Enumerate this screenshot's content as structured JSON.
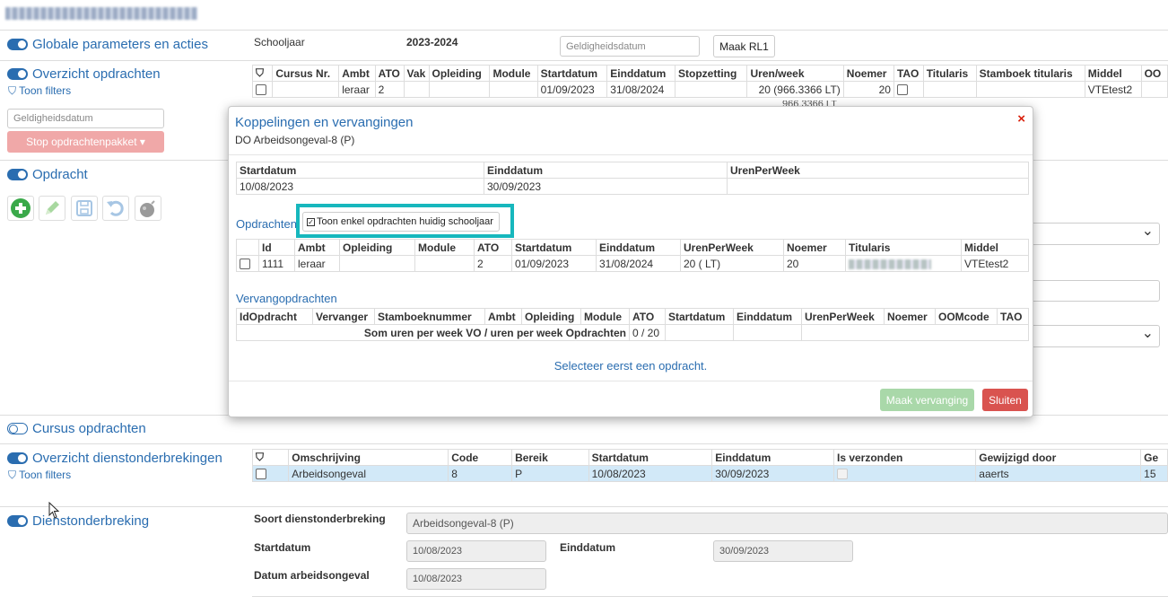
{
  "sections": {
    "globale": {
      "title": "Globale parameters en acties"
    },
    "overzicht_opdrachten": {
      "title": "Overzicht opdrachten",
      "filter_link": "Toon filters"
    },
    "opdracht": {
      "title": "Opdracht"
    },
    "cursus": {
      "title": "Cursus opdrachten"
    },
    "overzicht_dienst": {
      "title": "Overzicht dienstonderbrekingen",
      "filter_link": "Toon filters"
    },
    "dienstonderbreking": {
      "title": "Dienstonderbreking"
    }
  },
  "globale_params": {
    "schooljaar_label": "Schooljaar",
    "schooljaar_value": "2023-2024",
    "datum_placeholder": "Geldigheidsdatum",
    "maak_rl1": "Maak RL1"
  },
  "left_panel": {
    "datum_placeholder": "Geldigheidsdatum",
    "stop_button": "Stop opdrachtenpakket ▾"
  },
  "opdrachten_table": {
    "headers": [
      "Cursus Nr.",
      "Ambt",
      "ATO",
      "Vak",
      "Opleiding",
      "Module",
      "Startdatum",
      "Einddatum",
      "Stopzetting",
      "Uren/week",
      "Noemer",
      "TAO",
      "Titularis",
      "Stamboek titularis",
      "Middel",
      "OO"
    ],
    "row": [
      "",
      "leraar",
      "2",
      "",
      "",
      "",
      "01/09/2023",
      "31/08/2024",
      "",
      "20 (966.3366 LT)",
      "20",
      "",
      "",
      "",
      "VTEtest2",
      ""
    ],
    "partial": "966.3366 LT"
  },
  "dienst_table": {
    "headers": [
      "Omschrijving",
      "Code",
      "Bereik",
      "Startdatum",
      "Einddatum",
      "Is verzonden",
      "Gewijzigd door",
      "Ge"
    ],
    "row": [
      "Arbeidsongeval",
      "8",
      "P",
      "10/08/2023",
      "30/09/2023",
      "",
      "aaerts",
      "15"
    ]
  },
  "dienstonderbreking_form": {
    "soort_label": "Soort dienstonderbreking",
    "soort_value": "Arbeidsongeval-8 (P)",
    "start_label": "Startdatum",
    "start_value": "10/08/2023",
    "eind_label": "Einddatum",
    "eind_value": "30/09/2023",
    "datum_label": "Datum arbeidsongeval",
    "datum_value": "10/08/2023"
  },
  "modal": {
    "title": "Koppelingen en vervangingen",
    "subtitle": "DO Arbeidsongeval-8 (P)",
    "close": "×",
    "period": {
      "headers": [
        "Startdatum",
        "Einddatum",
        "UrenPerWeek"
      ],
      "row": [
        "10/08/2023",
        "30/09/2023",
        ""
      ]
    },
    "opdrachten_label": "Opdrachten",
    "toggle_label": "Toon enkel opdrachten huidig schooljaar",
    "opdrachten_table": {
      "headers": [
        "Id",
        "Ambt",
        "Opleiding",
        "Module",
        "ATO",
        "Startdatum",
        "Einddatum",
        "UrenPerWeek",
        "Noemer",
        "Titularis",
        "Middel"
      ],
      "row": [
        "1111",
        "leraar",
        "",
        "",
        "2",
        "01/09/2023",
        "31/08/2024",
        "20 ( LT)",
        "20",
        "",
        "VTEtest2"
      ]
    },
    "vervang_label": "Vervangopdrachten",
    "vervang_table": {
      "headers": [
        "IdOpdracht",
        "Vervanger",
        "Stamboeknummer",
        "Ambt",
        "Opleiding",
        "Module",
        "ATO",
        "Startdatum",
        "Einddatum",
        "UrenPerWeek",
        "Noemer",
        "OOMcode",
        "TAO"
      ],
      "sum_label": "Som uren per week VO / uren per week Opdrachten",
      "sum_value": "0 / 20"
    },
    "info": "Selecteer eerst een opdracht.",
    "maak_vervanging": "Maak vervanging",
    "sluiten": "Sluiten"
  },
  "colors": {
    "accent": "#2a6db0",
    "teal": "#17b7bd",
    "danger": "#d9534f",
    "success_disabled": "#a9d8a9"
  }
}
